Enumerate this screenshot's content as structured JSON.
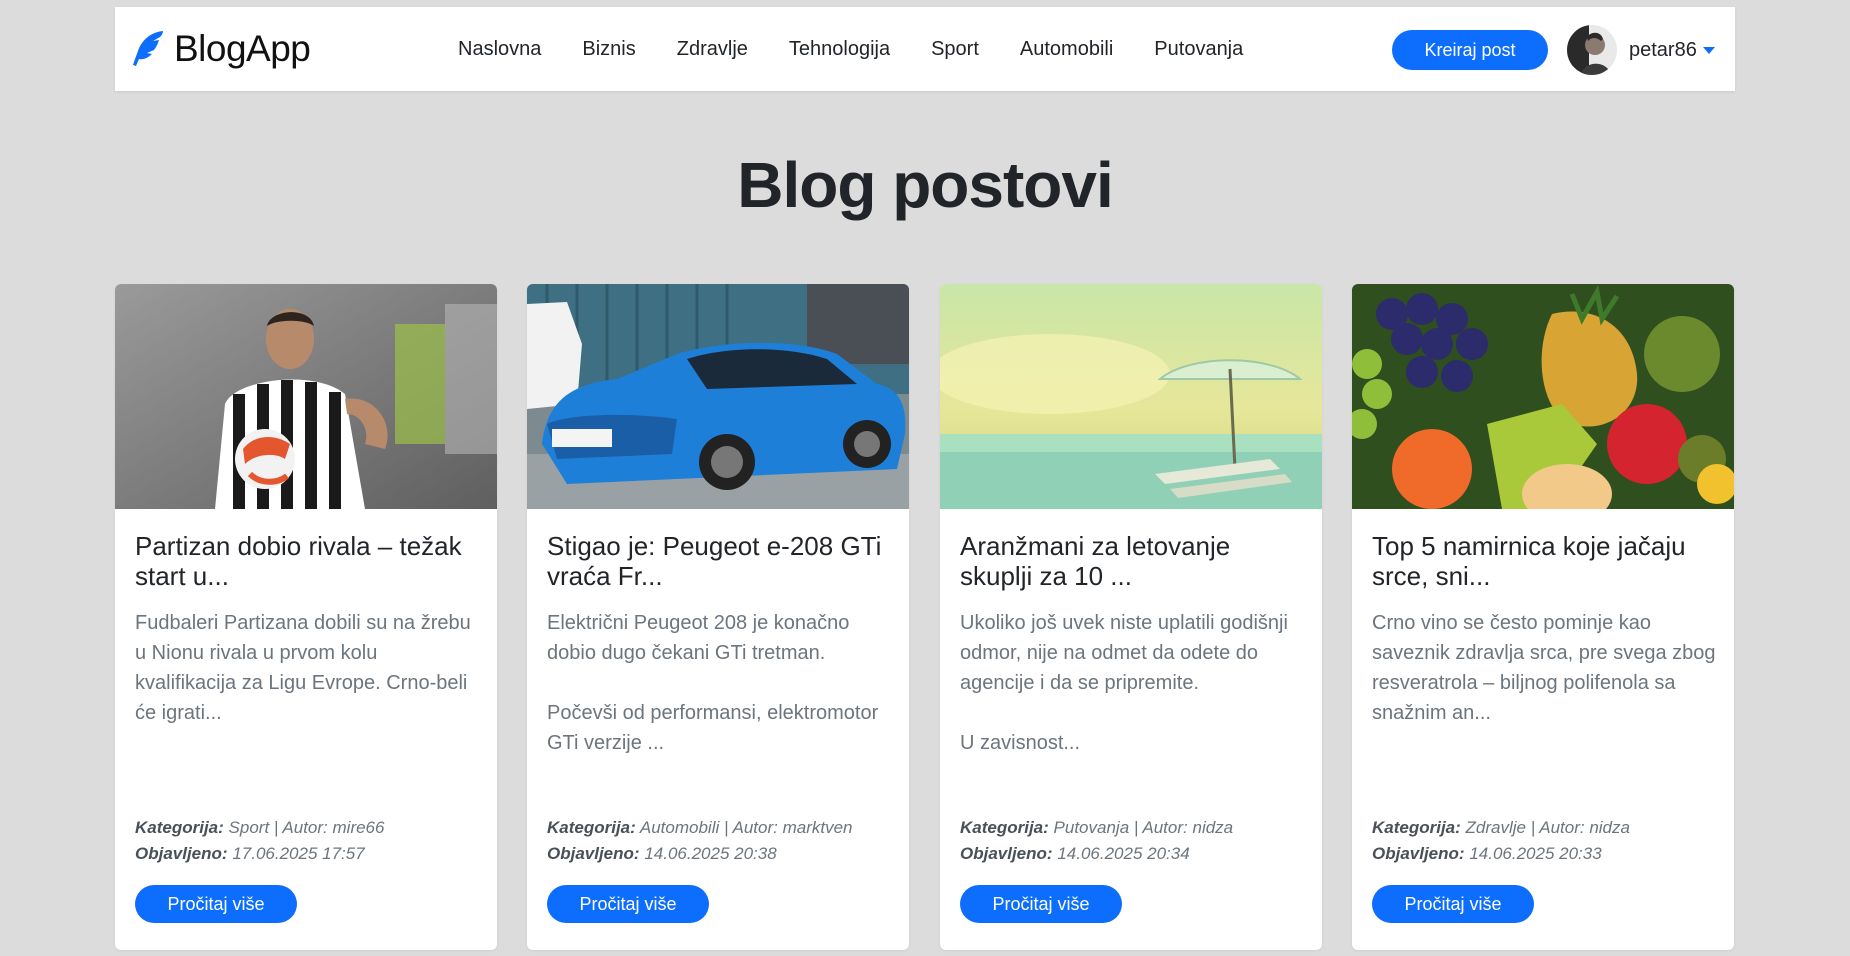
{
  "brand": {
    "name": "BlogApp",
    "accent": "#0d6efd"
  },
  "nav": {
    "items": [
      {
        "label": "Naslovna"
      },
      {
        "label": "Biznis"
      },
      {
        "label": "Zdravlje"
      },
      {
        "label": "Tehnologija"
      },
      {
        "label": "Sport"
      },
      {
        "label": "Automobili"
      },
      {
        "label": "Putovanja"
      }
    ],
    "create_label": "Kreiraj post",
    "username": "petar86"
  },
  "page": {
    "title": "Blog postovi"
  },
  "posts": [
    {
      "title": "Partizan dobio rivala – težak start u...",
      "excerpt": "Fudbaleri Partizana dobili su na žrebu u Nionu rivala u prvom kolu kvalifikacija za Ligu Evrope. Crno-beli će igrati...",
      "category_label": "Kategorija:",
      "category": "Sport",
      "author_label": "Autor:",
      "author": "mire66",
      "published_label": "Objavljeno:",
      "published": "17.06.2025 17:57",
      "button_label": "Pročitaj više",
      "image": "football-player-photo"
    },
    {
      "title": "Stigao je: Peugeot e-208 GTi vraća Fr...",
      "excerpt": "Električni Peugeot 208 je konačno dobio dugo čekani GTi tretman.\n\nPočevši od performansi, elektromotor GTi verzije ...",
      "category_label": "Kategorija:",
      "category": "Automobili",
      "author_label": "Autor:",
      "author": "marktven",
      "published_label": "Objavljeno:",
      "published": "14.06.2025 20:38",
      "button_label": "Pročitaj više",
      "image": "blue-car-photo"
    },
    {
      "title": "Aranžmani za letovanje skuplji za 10 ...",
      "excerpt": "Ukoliko još uvek niste uplatili godišnji odmor, nije na odmet da odete do agencije i da se pripremite.\n\nU zavisnost...",
      "category_label": "Kategorija:",
      "category": "Putovanja",
      "author_label": "Autor:",
      "author": "nidza",
      "published_label": "Objavljeno:",
      "published": "14.06.2025 20:34",
      "button_label": "Pročitaj više",
      "image": "beach-photo"
    },
    {
      "title": "Top 5 namirnica koje jačaju srce, sni...",
      "excerpt": "Crno vino se često pominje kao saveznik zdravlja srca, pre svega zbog resveratrola – biljnog polifenola sa snažnim an...",
      "category_label": "Kategorija:",
      "category": "Zdravlje",
      "author_label": "Autor:",
      "author": "nidza",
      "published_label": "Objavljeno:",
      "published": "14.06.2025 20:33",
      "button_label": "Pročitaj više",
      "image": "fruit-photo"
    }
  ]
}
